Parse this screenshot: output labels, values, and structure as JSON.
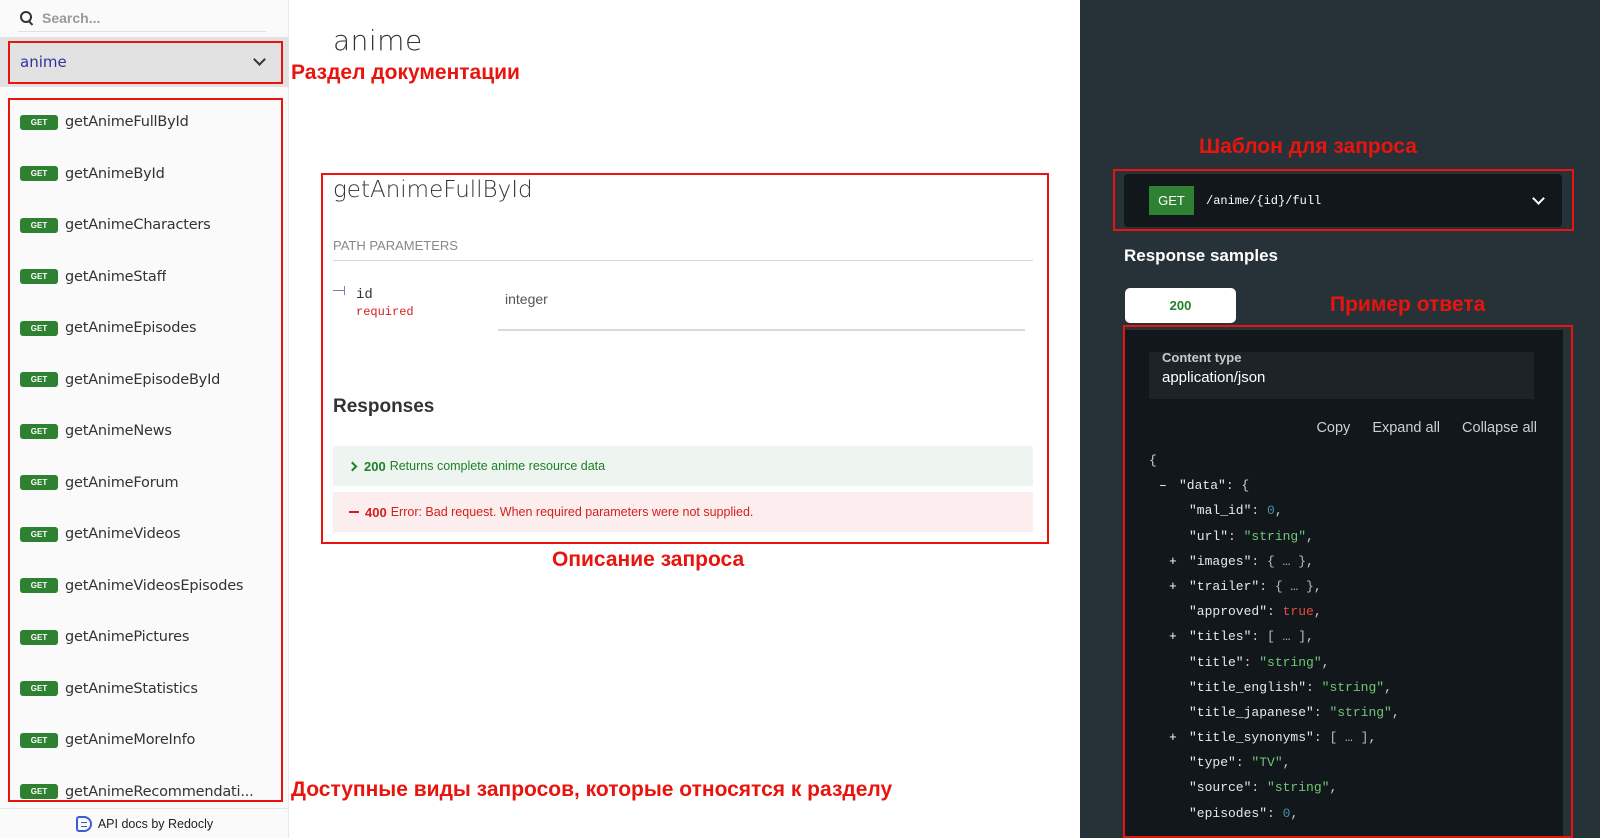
{
  "sidebar": {
    "search_placeholder": "Search...",
    "section_selected": "anime",
    "operations": [
      {
        "method": "GET",
        "name": "getAnimeFullById"
      },
      {
        "method": "GET",
        "name": "getAnimeById"
      },
      {
        "method": "GET",
        "name": "getAnimeCharacters"
      },
      {
        "method": "GET",
        "name": "getAnimeStaff"
      },
      {
        "method": "GET",
        "name": "getAnimeEpisodes"
      },
      {
        "method": "GET",
        "name": "getAnimeEpisodeById"
      },
      {
        "method": "GET",
        "name": "getAnimeNews"
      },
      {
        "method": "GET",
        "name": "getAnimeForum"
      },
      {
        "method": "GET",
        "name": "getAnimeVideos"
      },
      {
        "method": "GET",
        "name": "getAnimeVideosEpisodes"
      },
      {
        "method": "GET",
        "name": "getAnimePictures"
      },
      {
        "method": "GET",
        "name": "getAnimeStatistics"
      },
      {
        "method": "GET",
        "name": "getAnimeMoreInfo"
      },
      {
        "method": "GET",
        "name": "getAnimeRecommendati..."
      }
    ],
    "footer": "API docs by Redocly"
  },
  "middle": {
    "section_title": "anime",
    "operation_title": "getAnimeFullById",
    "path_params_label": "PATH PARAMETERS",
    "param": {
      "name": "id",
      "required": "required",
      "type": "integer"
    },
    "responses_title": "Responses",
    "responses": [
      {
        "code": "200",
        "text": "Returns complete anime resource data",
        "status": "success"
      },
      {
        "code": "400",
        "text": "Error: Bad request. When required parameters were not supplied.",
        "status": "error"
      }
    ]
  },
  "right": {
    "endpoint": {
      "method": "GET",
      "path": "/anime/{id}/full"
    },
    "response_samples_title": "Response samples",
    "active_tab": "200",
    "content_type_label": "Content type",
    "content_type_value": "application/json",
    "actions": {
      "copy": "Copy",
      "expand_all": "Expand all",
      "collapse_all": "Collapse all"
    },
    "json_lines": [
      {
        "indent": 0,
        "toggle": "",
        "key": "",
        "value": "{",
        "vtype": "punct"
      },
      {
        "indent": 1,
        "toggle": "–",
        "key": "\"data\"",
        "value": "{",
        "vtype": "punct"
      },
      {
        "indent": 2,
        "toggle": "",
        "key": "\"mal_id\"",
        "value": "0",
        "vtype": "num"
      },
      {
        "indent": 2,
        "toggle": "",
        "key": "\"url\"",
        "value": "\"string\"",
        "vtype": "str"
      },
      {
        "indent": 2,
        "toggle": "+",
        "key": "\"images\"",
        "value": "{ … }",
        "vtype": "ellip"
      },
      {
        "indent": 2,
        "toggle": "+",
        "key": "\"trailer\"",
        "value": "{ … }",
        "vtype": "ellip"
      },
      {
        "indent": 2,
        "toggle": "",
        "key": "\"approved\"",
        "value": "true",
        "vtype": "bool"
      },
      {
        "indent": 2,
        "toggle": "+",
        "key": "\"titles\"",
        "value": "[ … ]",
        "vtype": "ellip"
      },
      {
        "indent": 2,
        "toggle": "",
        "key": "\"title\"",
        "value": "\"string\"",
        "vtype": "str"
      },
      {
        "indent": 2,
        "toggle": "",
        "key": "\"title_english\"",
        "value": "\"string\"",
        "vtype": "str"
      },
      {
        "indent": 2,
        "toggle": "",
        "key": "\"title_japanese\"",
        "value": "\"string\"",
        "vtype": "str"
      },
      {
        "indent": 2,
        "toggle": "+",
        "key": "\"title_synonyms\"",
        "value": "[ … ]",
        "vtype": "ellip"
      },
      {
        "indent": 2,
        "toggle": "",
        "key": "\"type\"",
        "value": "\"TV\"",
        "vtype": "str"
      },
      {
        "indent": 2,
        "toggle": "",
        "key": "\"source\"",
        "value": "\"string\"",
        "vtype": "str"
      },
      {
        "indent": 2,
        "toggle": "",
        "key": "\"episodes\"",
        "value": "0",
        "vtype": "num"
      }
    ]
  },
  "annotations": {
    "section": "Раздел документации",
    "operations": "Доступные виды запросов, которые относятся к разделу",
    "description": "Описание запроса",
    "template": "Шаблон для запроса",
    "example": "Пример ответа"
  },
  "colors": {
    "get_badge": "#2f8132",
    "annotation_red": "#e8140d",
    "dark_panel": "#263238",
    "code_bg": "#11171a",
    "success": "#1d8127",
    "error": "#d41f1c"
  }
}
